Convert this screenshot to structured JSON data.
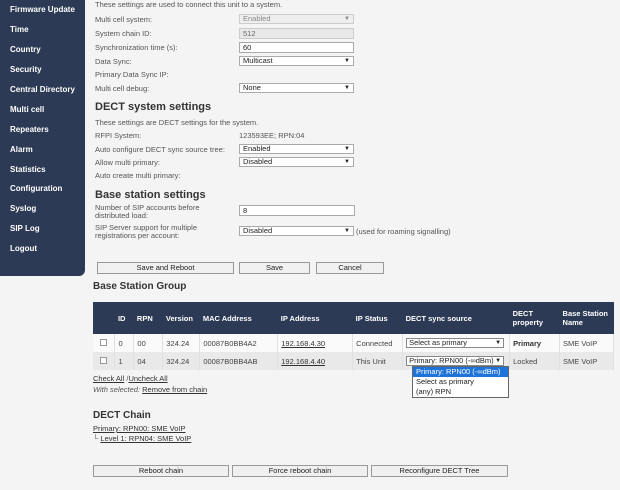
{
  "sidebar": {
    "items": [
      {
        "label": "Firmware Update"
      },
      {
        "label": "Time"
      },
      {
        "label": "Country"
      },
      {
        "label": "Security"
      },
      {
        "label": "Central Directory"
      },
      {
        "label": "Multi cell"
      },
      {
        "label": "Repeaters"
      },
      {
        "label": "Alarm"
      },
      {
        "label": "Statistics"
      },
      {
        "label": "Configuration"
      },
      {
        "label": "Syslog"
      },
      {
        "label": "SIP Log"
      },
      {
        "label": "Logout"
      }
    ]
  },
  "multicell": {
    "intro": "These settings are used to connect this unit to a system.",
    "multi_cell_system_label": "Multi cell system:",
    "multi_cell_system_value": "Enabled",
    "system_chain_id_label": "System chain ID:",
    "system_chain_id_value": "512",
    "sync_time_label": "Synchronization time (s):",
    "sync_time_value": "60",
    "data_sync_label": "Data Sync:",
    "data_sync_value": "Multicast",
    "primary_sync_ip_label": "Primary Data Sync IP:",
    "debug_label": "Multi cell debug:",
    "debug_value": "None"
  },
  "dect": {
    "heading": "DECT system settings",
    "intro": "These settings are DECT settings for the system.",
    "rfpi_label": "RFPI System:",
    "rfpi_value": "123593EE; RPN:04",
    "auto_cfg_label": "Auto configure DECT sync source tree:",
    "auto_cfg_value": "Enabled",
    "allow_multi_label": "Allow multi primary:",
    "allow_multi_value": "Disabled",
    "auto_create_label": "Auto create multi primary:"
  },
  "base": {
    "heading": "Base station settings",
    "sip_accounts_label_1": "Number of SIP accounts before",
    "sip_accounts_label_2": "distributed load:",
    "sip_accounts_value": "8",
    "sip_server_label_1": "SIP Server support for multiple",
    "sip_server_label_2": "registrations per account:",
    "sip_server_value": "Disabled",
    "sip_server_note": "(used for roaming signalling)"
  },
  "buttons": {
    "save_reboot": "Save and Reboot",
    "save": "Save",
    "cancel": "Cancel"
  },
  "group": {
    "heading": "Base Station Group",
    "columns": [
      "ID",
      "RPN",
      "Version",
      "MAC Address",
      "IP Address",
      "IP Status",
      "DECT sync source",
      "DECT property",
      "Base Station Name"
    ],
    "rows": [
      {
        "id": "0",
        "rpn": "00",
        "version": "324.24",
        "mac": "00087B0BB4A2",
        "ip": "192.168.4.30",
        "status": "Connected",
        "sync": "Select as primary",
        "property": "Primary",
        "name": "SME VoIP"
      },
      {
        "id": "1",
        "rpn": "04",
        "version": "324.24",
        "mac": "00087B0BB4AB",
        "ip": "192.168.4.40",
        "status": "This Unit",
        "sync": "Primary: RPN00 (-∞dBm)",
        "property": "Locked",
        "name": "SME VoIP"
      }
    ],
    "check_all": "Check All",
    "uncheck_all": "Uncheck All",
    "with_selected": "With selected:",
    "remove_from_chain": "Remove from chain",
    "dropdown_options": [
      "Primary: RPN00 (-∞dBm)",
      "Select as primary",
      "(any) RPN"
    ]
  },
  "chain": {
    "heading": "DECT Chain",
    "primary": "Primary: RPN00: SME VoIP",
    "level1": "Level 1: RPN04: SME VoIP"
  },
  "bottom_buttons": {
    "reboot_chain": "Reboot chain",
    "force_reboot": "Force reboot chain",
    "reconfigure": "Reconfigure DECT Tree"
  }
}
